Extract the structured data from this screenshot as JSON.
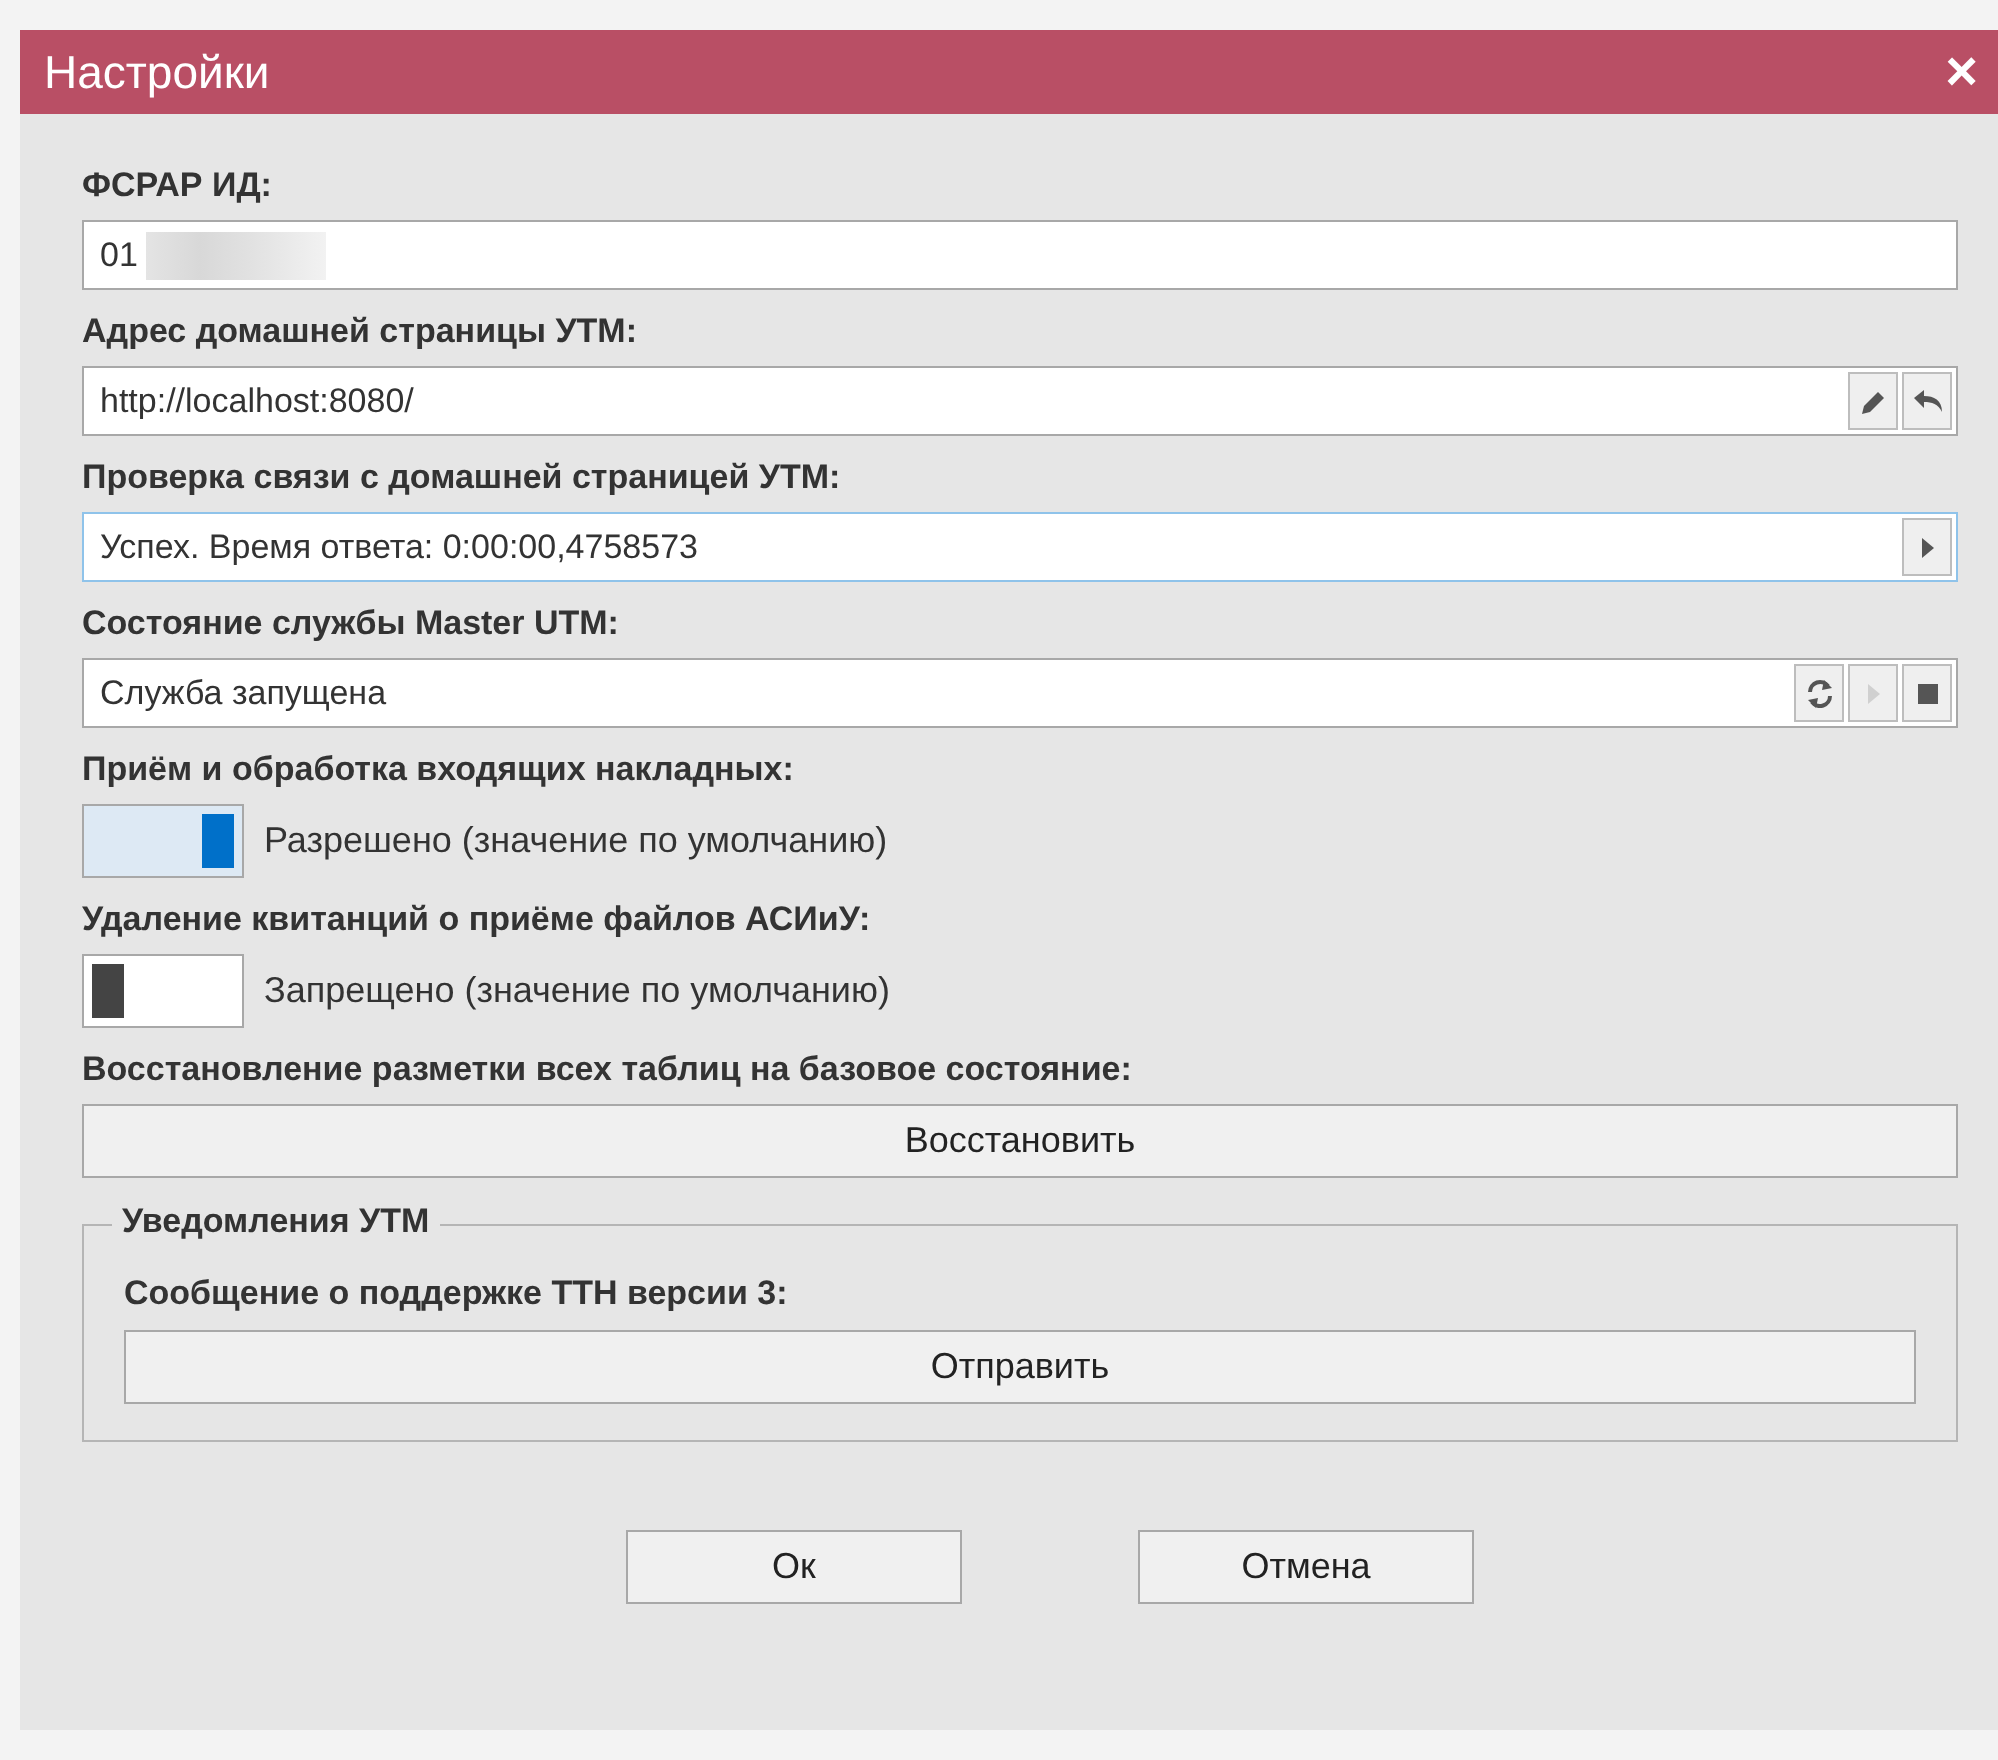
{
  "window": {
    "title": "Настройки",
    "close": "×"
  },
  "settings": [
    {
      "kind": "field",
      "label": "ФСРАР ИД:",
      "value": "01",
      "redacted": true,
      "focused": false
    },
    {
      "kind": "field",
      "label": "Адрес домашней страницы УТМ:",
      "value": "http://localhost:8080/",
      "focused": false,
      "buttons": [
        {
          "kind": "edit",
          "disabled": false
        },
        {
          "kind": "undo",
          "disabled": false
        }
      ]
    },
    {
      "kind": "field",
      "label": "Проверка связи с домашней страницей УТМ:",
      "value": "Успех. Время ответа: 0:00:00,4758573",
      "focused": true,
      "buttons": [
        {
          "kind": "play",
          "disabled": false
        }
      ]
    },
    {
      "kind": "field",
      "label": "Состояние службы Master UTM:",
      "value": "Служба запущена",
      "focused": false,
      "buttons": [
        {
          "kind": "refresh",
          "disabled": false
        },
        {
          "kind": "play",
          "disabled": true
        },
        {
          "kind": "stop",
          "disabled": false
        }
      ]
    },
    {
      "kind": "toggle",
      "label": "Приём и обработка входящих накладных:",
      "on": true,
      "text": "Разрешено (значение по умолчанию)"
    },
    {
      "kind": "toggle",
      "label": "Удаление квитанций о приёме файлов АСИиУ:",
      "on": false,
      "text": "Запрещено (значение по умолчанию)"
    },
    {
      "kind": "action",
      "label": "Восстановление разметки всех таблиц на базовое состояние:",
      "button": "Восстановить"
    }
  ],
  "group": {
    "title": "Уведомления УТМ",
    "label": "Сообщение о поддержке ТТН версии 3:",
    "button": "Отправить"
  },
  "buttons": [
    "Ок",
    "Отмена"
  ]
}
